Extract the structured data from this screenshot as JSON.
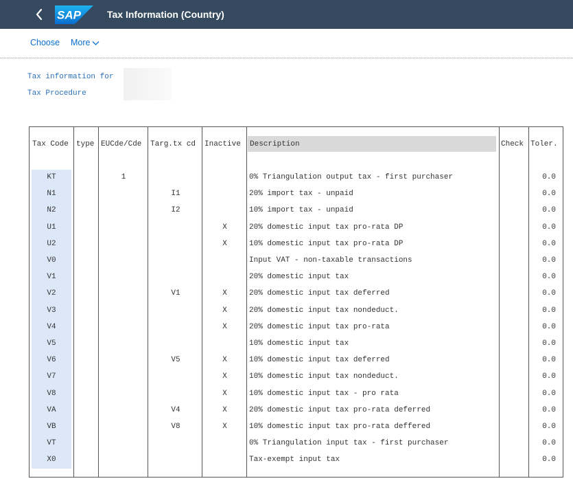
{
  "shell": {
    "title": "Tax Information (Country)",
    "logo_text": "SAP",
    "colors": {
      "shell_bg": "#354a5f",
      "logo_blue": "#0a6ed1",
      "link": "#0a6ed1"
    }
  },
  "toolbar": {
    "choose_label": "Choose",
    "more_label": "More"
  },
  "info": {
    "tax_info_label": "Tax information for",
    "tax_procedure_label": "Tax Procedure"
  },
  "table": {
    "headers": {
      "tax_code": "Tax Code",
      "type": "type",
      "eucde": "EUCde/Cde",
      "targ": "Targ.tx cd",
      "inactive": "Inactive",
      "description": "Description",
      "check": "Check",
      "toler": "Toler."
    },
    "rows": [
      {
        "code": "KT",
        "eu": "1",
        "targ": "",
        "inactive": "",
        "desc": "0% Triangulation output tax - first purchaser",
        "tol": "0.0"
      },
      {
        "code": "N1",
        "eu": "",
        "targ": "I1",
        "inactive": "",
        "desc": "20% import tax - unpaid",
        "tol": "0.0"
      },
      {
        "code": "N2",
        "eu": "",
        "targ": "I2",
        "inactive": "",
        "desc": "10% import tax - unpaid",
        "tol": "0.0"
      },
      {
        "code": "U1",
        "eu": "",
        "targ": "",
        "inactive": "X",
        "desc": "20% domestic input tax pro-rata DP",
        "tol": "0.0"
      },
      {
        "code": "U2",
        "eu": "",
        "targ": "",
        "inactive": "X",
        "desc": "10% domestic input tax pro-rata DP",
        "tol": "0.0"
      },
      {
        "code": "V0",
        "eu": "",
        "targ": "",
        "inactive": "",
        "desc": "Input VAT  - non-taxable transactions",
        "tol": "0.0"
      },
      {
        "code": "V1",
        "eu": "",
        "targ": "",
        "inactive": "",
        "desc": "20% domestic input tax",
        "tol": "0.0"
      },
      {
        "code": "V2",
        "eu": "",
        "targ": "V1",
        "inactive": "X",
        "desc": "20% domestic input tax deferred",
        "tol": "0.0"
      },
      {
        "code": "V3",
        "eu": "",
        "targ": "",
        "inactive": "X",
        "desc": "20% domestic input tax nondeduct.",
        "tol": "0.0"
      },
      {
        "code": "V4",
        "eu": "",
        "targ": "",
        "inactive": "X",
        "desc": "20% domestic input tax pro-rata",
        "tol": "0.0"
      },
      {
        "code": "V5",
        "eu": "",
        "targ": "",
        "inactive": "",
        "desc": "10% domestic input tax",
        "tol": "0.0"
      },
      {
        "code": "V6",
        "eu": "",
        "targ": "V5",
        "inactive": "X",
        "desc": "10% domestic input tax deferred",
        "tol": "0.0"
      },
      {
        "code": "V7",
        "eu": "",
        "targ": "",
        "inactive": "X",
        "desc": "10% domestic input tax nondeduct.",
        "tol": "0.0"
      },
      {
        "code": "V8",
        "eu": "",
        "targ": "",
        "inactive": "X",
        "desc": "10% domestic input tax - pro rata",
        "tol": "0.0"
      },
      {
        "code": "VA",
        "eu": "",
        "targ": "V4",
        "inactive": "X",
        "desc": "20% domestic input tax pro-rata deferred",
        "tol": "0.0"
      },
      {
        "code": "VB",
        "eu": "",
        "targ": "V8",
        "inactive": "X",
        "desc": "10% domestic input tax pro-rata deffered",
        "tol": "0.0"
      },
      {
        "code": "VT",
        "eu": "",
        "targ": "",
        "inactive": "",
        "desc": "0% Triangulation input tax - first purchaser",
        "tol": "0.0"
      },
      {
        "code": "X0",
        "eu": "",
        "targ": "",
        "inactive": "",
        "desc": "Tax-exempt input tax",
        "tol": "0.0"
      }
    ]
  }
}
